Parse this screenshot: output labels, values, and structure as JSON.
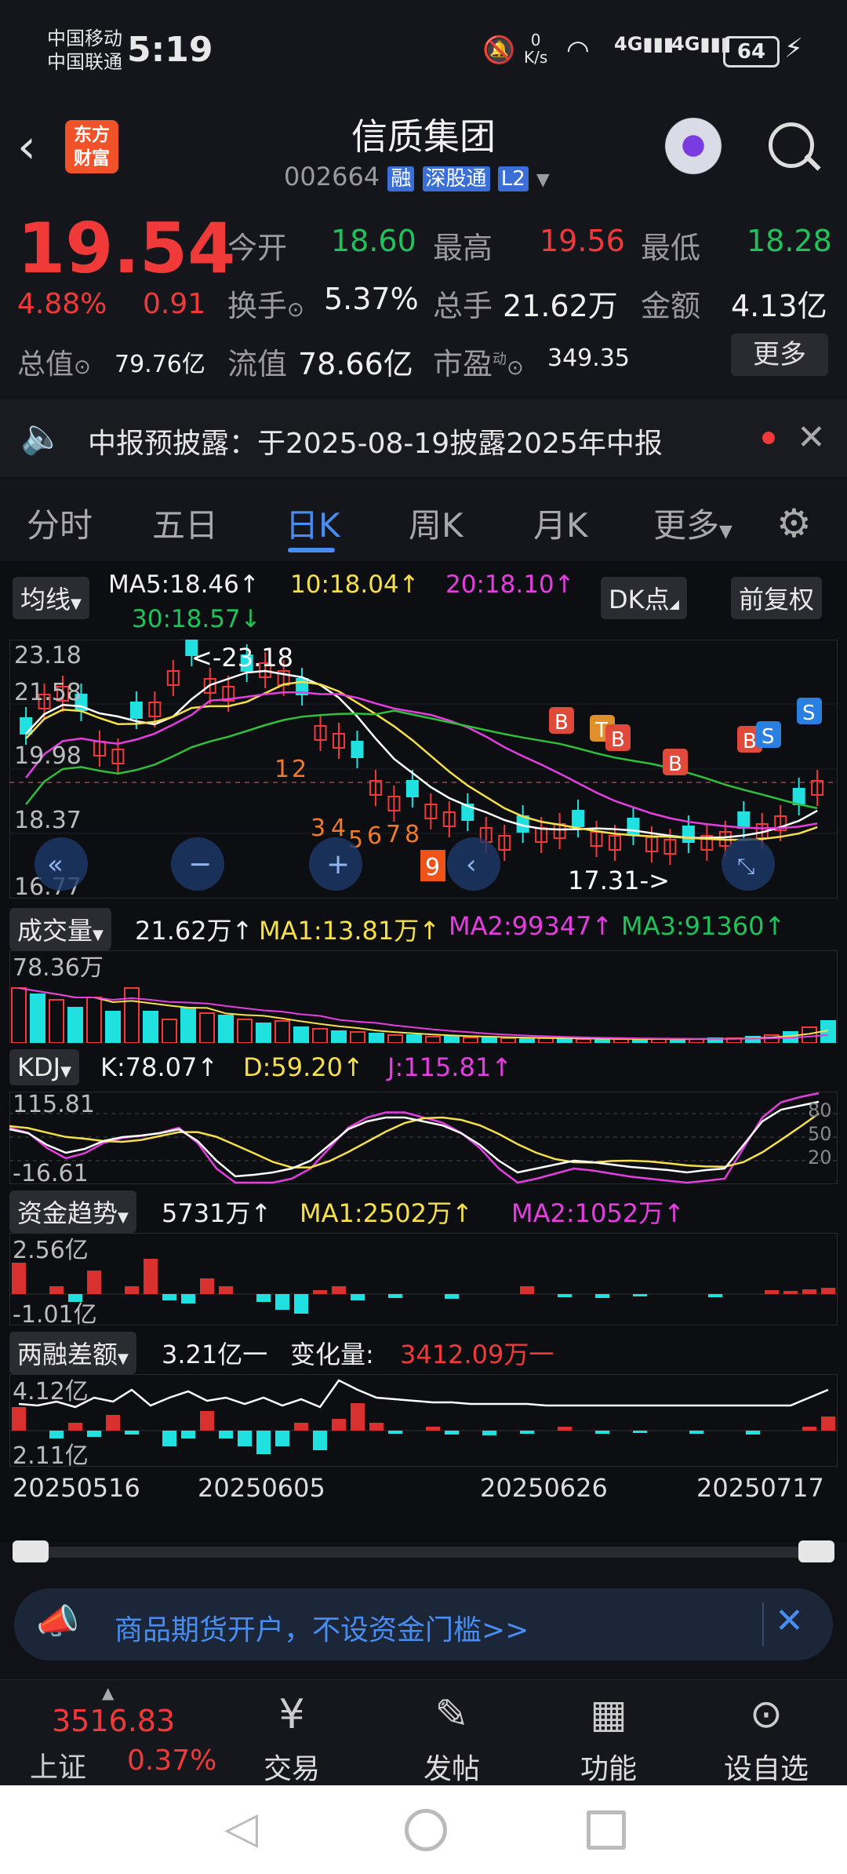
{
  "status": {
    "carrier1": "中国移动",
    "carrier2": "中国联通",
    "time": "5:19",
    "net_speed_top": "0",
    "net_speed_unit": "K/s",
    "signal1": "4G",
    "signal2": "4G",
    "battery": "64"
  },
  "header": {
    "back_icon": "chevron-left-icon",
    "logo_line1": "东方",
    "logo_line2": "财富",
    "title": "信质集团",
    "code": "002664",
    "badges": [
      "融",
      "深股通",
      "L2"
    ],
    "search_icon": "search-icon"
  },
  "quote": {
    "price": "19.54",
    "change_pct": "4.88%",
    "change": "0.91",
    "open_label": "今开",
    "open": "18.60",
    "high_label": "最高",
    "high": "19.56",
    "low_label": "最低",
    "low": "18.28",
    "turnover_label": "换手",
    "turnover": "5.37%",
    "volume_label": "总手",
    "volume": "21.62万",
    "amount_label": "金额",
    "amount": "4.13亿",
    "mcap_label": "总值",
    "mcap": "79.76亿",
    "float_label": "流值",
    "float": "78.66亿",
    "pe_label": "市盈",
    "pe_sup": "动",
    "pe": "349.35",
    "more_label": "更多"
  },
  "notice": {
    "text": "中报预披露：于2025-08-19披露2025年中报"
  },
  "tabs": [
    "分时",
    "五日",
    "日K",
    "周K",
    "月K",
    "更多"
  ],
  "active_tab": "日K",
  "ma_bar": {
    "chip": "均线",
    "ma5": "MA5:18.46↑",
    "ma10": "10:18.04↑",
    "ma20": "20:18.10↑",
    "ma30": "30:18.57↓",
    "dk_label": "DK点",
    "fq_label": "前复权"
  },
  "kline": {
    "axis_labels": [
      "23.18",
      "21.58",
      "19.98",
      "18.37",
      "16.77"
    ],
    "high_annotation": "<-23.18",
    "low_annotation": "17.31->",
    "signals": [
      "B",
      "T",
      "B",
      "B",
      "B",
      "S",
      "S"
    ],
    "sequence": [
      "1",
      "2",
      "3",
      "4",
      "5",
      "6",
      "7",
      "8",
      "9"
    ]
  },
  "volume": {
    "chip": "成交量",
    "value": "21.62万↑",
    "ma1": "MA1:13.81万↑",
    "ma2": "MA2:99347↑",
    "ma3": "MA3:91360↑",
    "axis_top": "78.36万"
  },
  "kdj": {
    "chip": "KDJ",
    "k": "K:78.07↑",
    "d": "D:59.20↑",
    "j": "J:115.81↑",
    "axis_top": "115.81",
    "axis_bottom": "-16.61",
    "level_80": "80",
    "level_50": "50",
    "level_20": "20"
  },
  "fund": {
    "chip": "资金趋势",
    "value": "5731万↑",
    "ma1": "MA1:2502万↑",
    "ma2": "MA2:1052万↑",
    "axis_top": "2.56亿",
    "axis_bottom": "-1.01亿"
  },
  "margin": {
    "chip": "两融差额",
    "value": "3.21亿一",
    "change_label": "变化量:",
    "change_value": "3412.09万一",
    "axis_top": "4.12亿",
    "axis_bottom": "2.11亿"
  },
  "dates": [
    "20250516",
    "20250605",
    "20250626",
    "20250717"
  ],
  "ad_banner": {
    "text": "商品期货开户，不设资金门槛>>"
  },
  "bottom_nav": {
    "index_value": "3516.83",
    "index_name": "上证",
    "index_pct": "0.37%",
    "items": [
      "交易",
      "发帖",
      "功能",
      "设自选"
    ]
  },
  "colors": {
    "up": "#f03a3a",
    "down": "#20e0e0",
    "ma5": "#ffffff",
    "ma10": "#f5e04b",
    "ma20": "#e43ee0",
    "ma30": "#2fbf3a"
  }
}
